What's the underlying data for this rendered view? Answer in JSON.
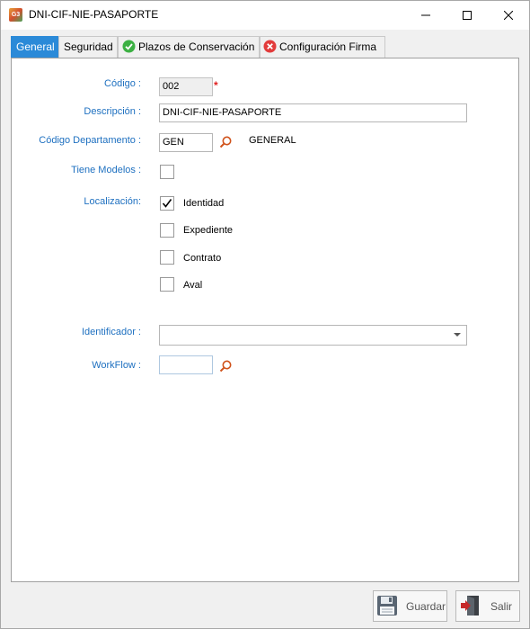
{
  "window": {
    "app_icon_text": "G3",
    "title": "DNI-CIF-NIE-PASAPORTE"
  },
  "tabs": [
    {
      "label": "General",
      "active": true
    },
    {
      "label": "Seguridad",
      "active": false
    },
    {
      "label": "Plazos de Conservación",
      "icon": "check-circle-icon",
      "active": false
    },
    {
      "label": "Configuración Firma",
      "icon": "error-circle-icon",
      "active": false
    }
  ],
  "form": {
    "codigo": {
      "label": "Código :",
      "value": "002",
      "required_mark": "*"
    },
    "descripcion": {
      "label": "Descripción :",
      "value": "DNI-CIF-NIE-PASAPORTE"
    },
    "departamento": {
      "label": "Código Departamento :",
      "value": "GEN",
      "name": "GENERAL"
    },
    "tiene_modelos": {
      "label": "Tiene Modelos :",
      "checked": false
    },
    "localizacion": {
      "label": "Localización:",
      "options": [
        {
          "label": "Identidad",
          "checked": true
        },
        {
          "label": "Expediente",
          "checked": false
        },
        {
          "label": "Contrato",
          "checked": false
        },
        {
          "label": "Aval",
          "checked": false
        }
      ]
    },
    "identificador": {
      "label": "Identificador :",
      "value": ""
    },
    "workflow": {
      "label": "WorkFlow :",
      "value": ""
    }
  },
  "buttons": {
    "guardar": "Guardar",
    "salir": "Salir"
  },
  "colors": {
    "accent": "#2b8ad8",
    "label": "#1e70c0",
    "required": "#e02020",
    "search_icon": "#d0531c"
  }
}
